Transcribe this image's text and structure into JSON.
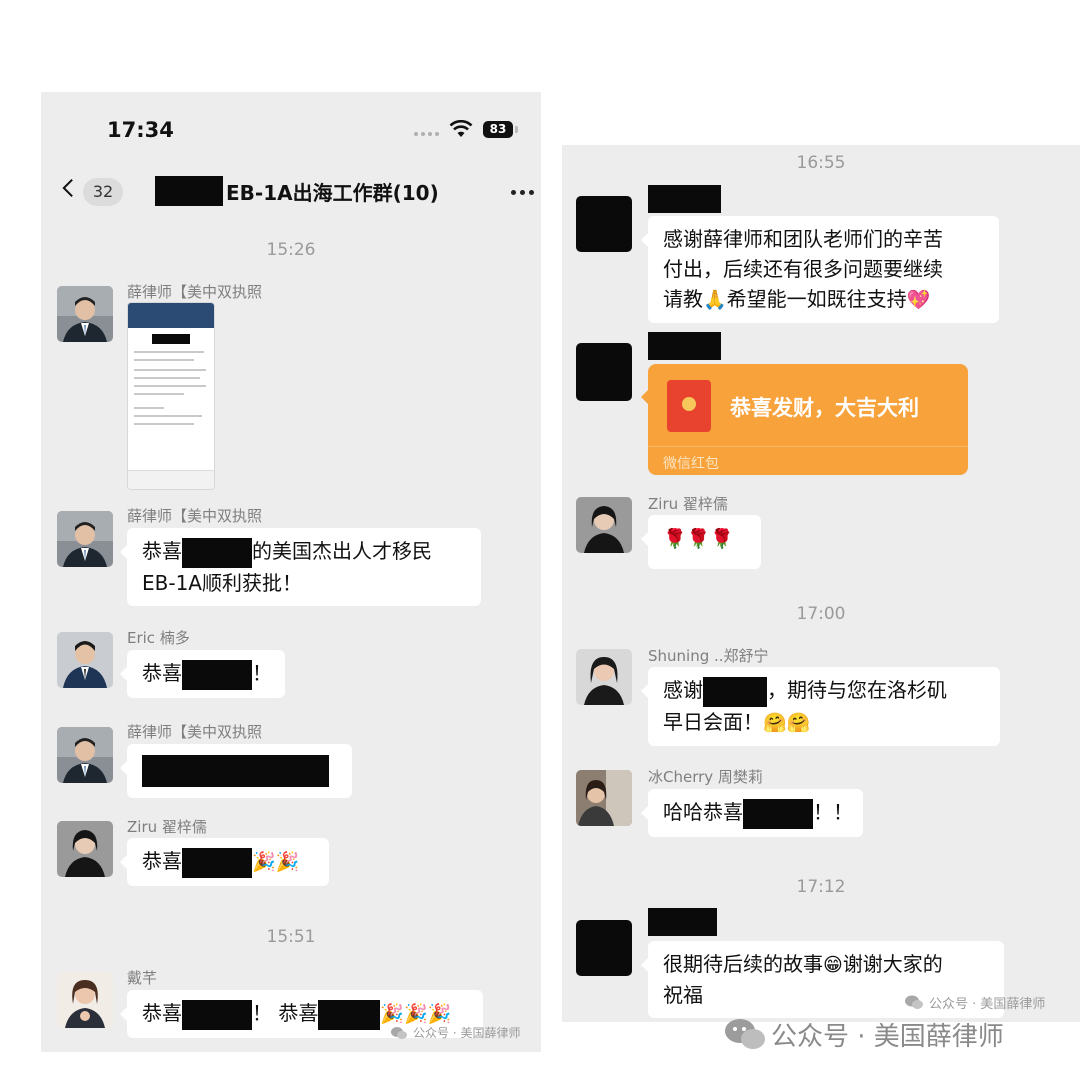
{
  "left": {
    "status_time": "17:34",
    "battery": "83",
    "unread_count": "32",
    "chat_title": "EB-1A出海工作群(10)",
    "times": [
      "15:26",
      "15:51"
    ],
    "messages": {
      "m1_name": "薛律师【美中双执照",
      "m2_name": "薛律师【美中双执照",
      "m2_text_a": "恭喜",
      "m2_text_b": "的美国杰出人才移民",
      "m2_text_c": "EB-1A顺利获批！",
      "m3_name": "Eric 楠多",
      "m3_text_a": "恭喜",
      "m3_text_b": "！",
      "m4_name": "薛律师【美中双执照",
      "m5_name": "Ziru 翟梓儒",
      "m5_text": "恭喜",
      "m5_emoji": "🎉🎉",
      "m6_name": "戴芊",
      "m6_text_a": "恭喜",
      "m6_text_b": "！ 恭喜",
      "m6_emoji": "🎉🎉🎉"
    },
    "watermark": "公众号 · 美国薛律师"
  },
  "right": {
    "times": [
      "16:55",
      "17:00",
      "17:12"
    ],
    "r1_text_a": "感谢薛律师和团队老师们的辛苦",
    "r1_text_b": "付出，后续还有很多问题要继续",
    "r1_text_c": "请教",
    "r1_text_d": "希望能一如既往支持",
    "r1_emoji_a": "🙏",
    "r1_emoji_b": "💖",
    "redpacket_text": "恭喜发财，大吉大利",
    "redpacket_label": "微信红包",
    "r3_name": "Ziru 翟梓儒",
    "r3_emoji": "🌹🌹🌹",
    "r4_name": "Shuning ..郑舒宁",
    "r4_text_a": "感谢",
    "r4_text_b": "，期待与您在洛杉矶",
    "r4_text_c": "早日会面！",
    "r4_emoji": "🤗🤗",
    "r5_name": "冰Cherry 周樊莉",
    "r5_text_a": "哈哈恭喜",
    "r5_text_b": "！！",
    "r6_text_a": "很期待后续的故事",
    "r6_emoji": "😁",
    "r6_text_b": "谢谢大家的",
    "r6_text_c": "祝福",
    "watermark_small": "公众号 · 美国薛律师",
    "watermark_large": "公众号 · 美国薛律师"
  }
}
